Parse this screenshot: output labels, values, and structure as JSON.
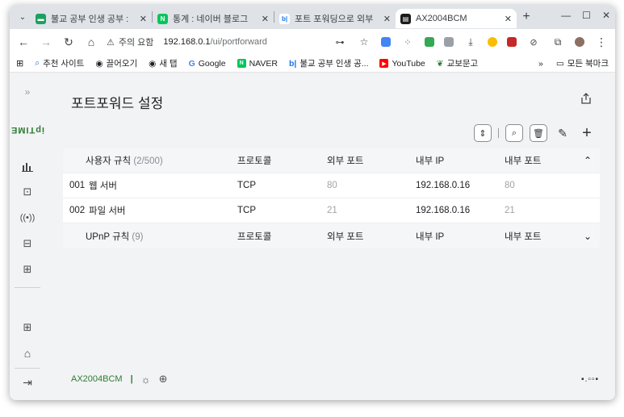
{
  "browser": {
    "tabs": [
      {
        "title": "불교 공부 인생 공부 :",
        "fav_color": "#1aa260",
        "fav_glyph": "▬"
      },
      {
        "title": "통계 : 네이버 블로그",
        "fav_color": "#03c75a",
        "fav_glyph": "N"
      },
      {
        "title": "포트 포워딩으로 외부",
        "fav_color": "#ffffff",
        "fav_glyph": "b|"
      },
      {
        "title": "AX2004BCM",
        "fav_color": "#1b1b1b",
        "fav_glyph": "▤"
      }
    ],
    "toolbar": {
      "security_label": "주의 요함",
      "url_host": "192.168.0.1",
      "url_path": "/ui/portforward"
    },
    "bookmarks": [
      {
        "label": "추천 사이트",
        "icon": "search-icon"
      },
      {
        "label": "끌어오기",
        "icon": "globe-icon"
      },
      {
        "label": "새 탭",
        "icon": "globe-icon"
      },
      {
        "label": "Google",
        "icon": "google-icon"
      },
      {
        "label": "NAVER",
        "icon": "naver-icon"
      },
      {
        "label": "불교 공부 인생 공...",
        "icon": "blog-icon"
      },
      {
        "label": "YouTube",
        "icon": "youtube-icon"
      },
      {
        "label": "교보문고",
        "icon": "kyobo-icon"
      }
    ],
    "bookmarks_more": "»",
    "all_bookmarks": "모든 북마크"
  },
  "app": {
    "page_title": "포트포워드 설정",
    "logo_text": "ipTIME",
    "table": {
      "user_rules_label": "사용자 규칙",
      "user_rules_count": "(2/500)",
      "columns": {
        "protocol": "프로토콜",
        "external_port": "외부 포트",
        "internal_ip": "내부 IP",
        "internal_port": "내부 포트"
      },
      "rows": [
        {
          "no": "001",
          "name": "웹 서버",
          "protocol": "TCP",
          "external_port": "80",
          "internal_ip": "192.168.0.16",
          "internal_port": "80"
        },
        {
          "no": "002",
          "name": "파일 서버",
          "protocol": "TCP",
          "external_port": "21",
          "internal_ip": "192.168.0.16",
          "internal_port": "21"
        }
      ],
      "upnp_label": "UPnP 규칙",
      "upnp_count": "(9)"
    },
    "footer": {
      "model": "AX2004BCM",
      "separator": "|"
    }
  }
}
